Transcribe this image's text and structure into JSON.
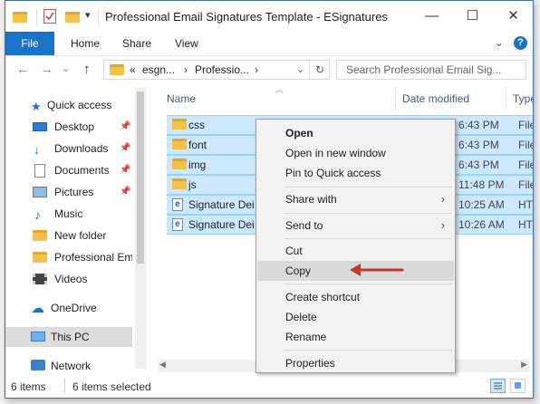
{
  "window": {
    "title": "Professional Email Signatures Template - ESignatures",
    "minimize": "—",
    "maximize": "☐",
    "close": "✕"
  },
  "ribbon": {
    "tabs": [
      "File",
      "Home",
      "Share",
      "View"
    ],
    "expand": "⌄",
    "help": "?"
  },
  "nav": {
    "back": "←",
    "forward": "→",
    "recent": "⌄",
    "up": "↑",
    "breadcrumb": [
      "«",
      "esgn...",
      "›",
      "Professio...",
      "›"
    ],
    "dropdown": "⌄",
    "refresh": "↻",
    "search_placeholder": "Search Professional Email Sig..."
  },
  "sidebar": {
    "items": [
      {
        "label": "Quick access",
        "icon": "star-icon",
        "pinned": false
      },
      {
        "label": "Desktop",
        "icon": "desktop-icon",
        "pinned": true
      },
      {
        "label": "Downloads",
        "icon": "download-icon",
        "pinned": true
      },
      {
        "label": "Documents",
        "icon": "documents-icon",
        "pinned": true
      },
      {
        "label": "Pictures",
        "icon": "pictures-icon",
        "pinned": true
      },
      {
        "label": "Music",
        "icon": "music-icon",
        "pinned": false
      },
      {
        "label": "New folder",
        "icon": "folder-icon",
        "pinned": false
      },
      {
        "label": "Professional Ema",
        "icon": "folder-icon",
        "pinned": false
      },
      {
        "label": "Videos",
        "icon": "videos-icon",
        "pinned": false
      },
      {
        "label": "OneDrive",
        "icon": "onedrive-icon",
        "pinned": false
      },
      {
        "label": "This PC",
        "icon": "pc-icon",
        "pinned": false
      },
      {
        "label": "Network",
        "icon": "network-icon",
        "pinned": false
      }
    ]
  },
  "columns": {
    "name": "Name",
    "date": "Date modified",
    "type": "Type"
  },
  "files": [
    {
      "name": "css",
      "icon": "folder-icon",
      "date": "6:43 PM",
      "type": "File"
    },
    {
      "name": "font",
      "icon": "folder-icon",
      "date": "6:43 PM",
      "type": "File"
    },
    {
      "name": "img",
      "icon": "folder-icon",
      "date": "6:43 PM",
      "type": "File"
    },
    {
      "name": "js",
      "icon": "folder-icon",
      "date": "11:48 PM",
      "type": "File"
    },
    {
      "name": "Signature Dei",
      "icon": "edge-file-icon",
      "date": "10:25 AM",
      "type": "HTM"
    },
    {
      "name": "Signature Dei",
      "icon": "edge-file-icon",
      "date": "10:26 AM",
      "type": "HTM"
    }
  ],
  "context_menu": {
    "open": "Open",
    "open_new_window": "Open in new window",
    "pin_quick_access": "Pin to Quick access",
    "share_with": "Share with",
    "send_to": "Send to",
    "cut": "Cut",
    "copy": "Copy",
    "create_shortcut": "Create shortcut",
    "delete": "Delete",
    "rename": "Rename",
    "properties": "Properties",
    "submenu_arrow": "›"
  },
  "status": {
    "items": "6 items",
    "selected": "6 items selected"
  },
  "colors": {
    "accent": "#1a73c7",
    "selection": "#cce8ff",
    "annotation_arrow": "#c0392b"
  }
}
